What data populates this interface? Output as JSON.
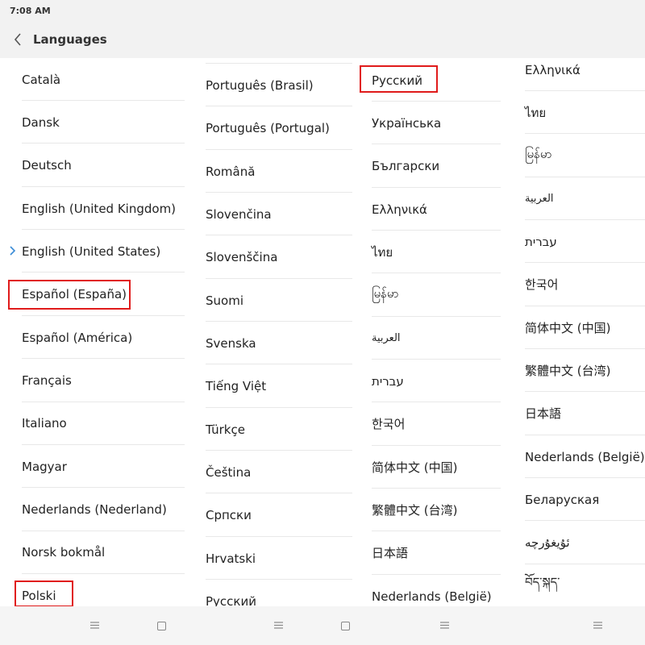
{
  "status_bar": {
    "time": "7:08 AM"
  },
  "header": {
    "title": "Languages"
  },
  "columns": [
    [
      "Català",
      "Dansk",
      "Deutsch",
      "English (United Kingdom)",
      "English (United States)",
      "Español (España)",
      "Español (América)",
      "Français",
      "Italiano",
      "Magyar",
      "Nederlands (Nederland)",
      "Norsk bokmål",
      "Polski"
    ],
    [
      "Português (Brasil)",
      "Português (Portugal)",
      "Română",
      "Slovenčina",
      "Slovenščina",
      "Suomi",
      "Svenska",
      "Tiếng Việt",
      "Türkçe",
      "Čeština",
      "Српски",
      "Hrvatski",
      "Русский"
    ],
    [
      "Русский",
      "Українська",
      "Български",
      "Ελληνικά",
      "ไทย",
      "မြန်မာ",
      "العربية",
      "עברית",
      "한국어",
      "简体中文 (中国)",
      "繁體中文 (台湾)",
      "日本語",
      "Nederlands (België)"
    ],
    [
      "Ελληνικά",
      "ไทย",
      "မြန်မာ",
      "العربية",
      "עברית",
      "한국어",
      "简体中文 (中国)",
      "繁體中文 (台湾)",
      "日本語",
      "Nederlands (België)",
      "Беларуская",
      "ئۇيغۇرچە",
      "བོད་སྐད་"
    ]
  ],
  "selected_language": "English (United States)",
  "highlighted": [
    "Español (España)",
    "Polski",
    "Русский"
  ],
  "colors": {
    "accent": "#3a8bd6",
    "highlight": "#e01b1b"
  },
  "icons": {
    "back": "chevron-left-icon",
    "selected": "chevron-right-icon",
    "menu": "menu-icon",
    "home": "home-icon"
  }
}
